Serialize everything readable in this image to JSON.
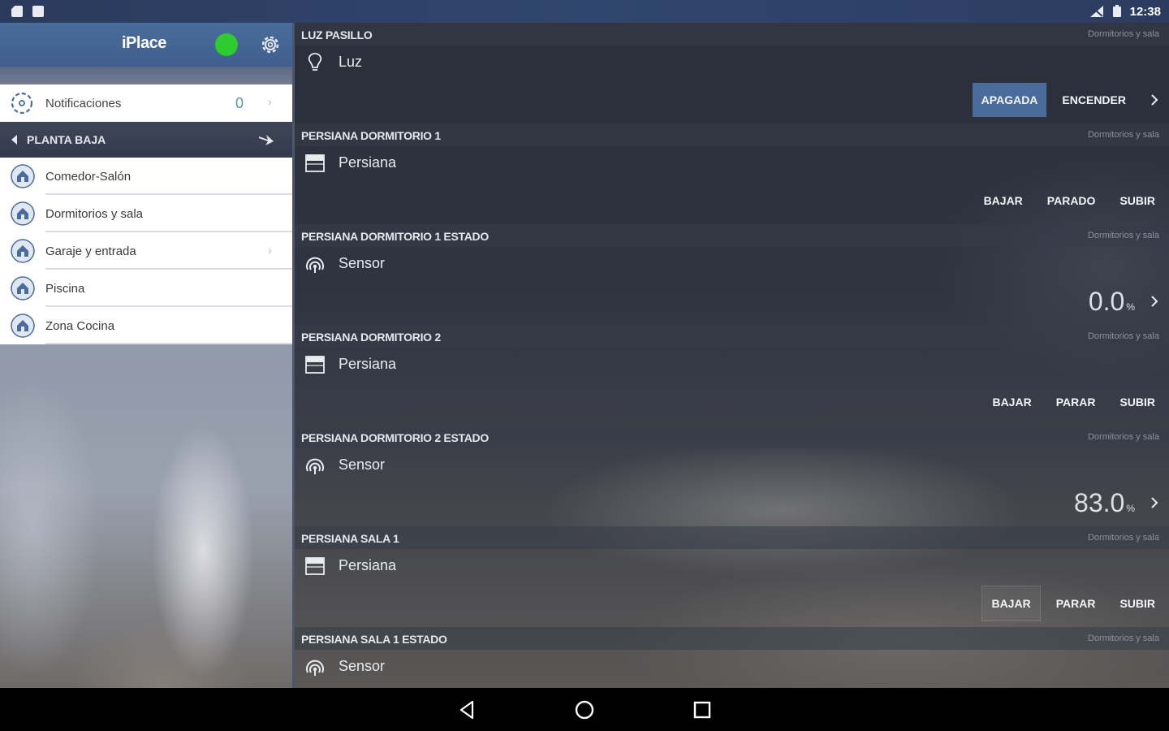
{
  "status_bar": {
    "time": "12:38",
    "icons": [
      "sd-card-icon",
      "square-notification-icon",
      "no-signal-icon",
      "battery-icon"
    ]
  },
  "sidebar": {
    "app_title": "iPlace",
    "notifications": {
      "label": "Notificaciones",
      "count": "0"
    },
    "floor": {
      "label": "PLANTA BAJA"
    },
    "rooms": [
      {
        "label": "Comedor-Salón"
      },
      {
        "label": "Dormitorios y sala"
      },
      {
        "label": "Garaje y entrada"
      },
      {
        "label": "Piscina"
      },
      {
        "label": "Zona Cocina"
      }
    ]
  },
  "devices": [
    {
      "name": "LUZ PASILLO",
      "room": "Dormitorios y sala",
      "type": "Luz",
      "icon": "lightbulb-icon",
      "actions": [
        "APAGADA",
        "ENCENDER"
      ]
    },
    {
      "name": "PERSIANA DORMITORIO 1",
      "room": "Dormitorios y sala",
      "type": "Persiana",
      "icon": "blind-icon",
      "actions": [
        "BAJAR",
        "PARADO",
        "SUBIR"
      ]
    },
    {
      "name": "PERSIANA DORMITORIO 1 ESTADO",
      "room": "Dormitorios y sala",
      "type": "Sensor",
      "icon": "sensor-icon",
      "value": "0.0",
      "unit": "%"
    },
    {
      "name": "PERSIANA DORMITORIO 2",
      "room": "Dormitorios y sala",
      "type": "Persiana",
      "icon": "blind-icon",
      "actions": [
        "BAJAR",
        "PARAR",
        "SUBIR"
      ]
    },
    {
      "name": "PERSIANA DORMITORIO 2 ESTADO",
      "room": "Dormitorios y sala",
      "type": "Sensor",
      "icon": "sensor-icon",
      "value": "83.0",
      "unit": "%"
    },
    {
      "name": "PERSIANA SALA 1",
      "room": "Dormitorios y sala",
      "type": "Persiana",
      "icon": "blind-icon",
      "actions": [
        "BAJAR",
        "PARAR",
        "SUBIR"
      ]
    },
    {
      "name": "PERSIANA SALA 1 ESTADO",
      "room": "Dormitorios y sala",
      "type": "Sensor",
      "icon": "sensor-icon"
    }
  ],
  "colors": {
    "accent": "#4a6c9c",
    "online": "#2ecc2e",
    "count": "#5b8ad0"
  }
}
